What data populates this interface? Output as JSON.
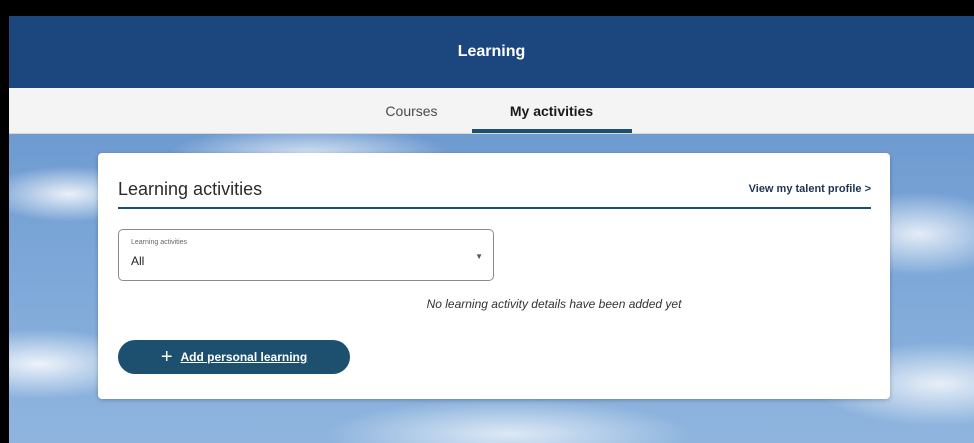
{
  "header": {
    "title": "Learning"
  },
  "tabs": [
    {
      "label": "Courses",
      "active": false
    },
    {
      "label": "My activities",
      "active": true
    }
  ],
  "card": {
    "title": "Learning activities",
    "talent_link": "View my talent profile >",
    "filter": {
      "label": "Learning activities",
      "value": "All"
    },
    "empty_message": "No learning activity details have been added yet",
    "add_button": "Add personal learning"
  },
  "colors": {
    "header_bg": "#1b467e",
    "accent": "#1d4f6e"
  },
  "icons": {
    "dropdown": "caret-down-icon",
    "add": "plus-icon"
  }
}
